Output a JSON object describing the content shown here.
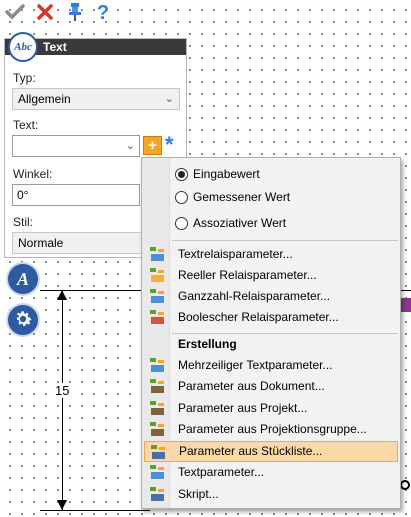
{
  "toolbar": {
    "icons": [
      "check-icon",
      "close-icon",
      "pin-icon",
      "help-icon"
    ],
    "help_glyph": "?"
  },
  "panel": {
    "title": "Text",
    "badge_text": "Abc",
    "type_label": "Typ:",
    "type_value": "Allgemein",
    "text_label": "Text:",
    "text_value": "",
    "plus_glyph": "+",
    "asterisk_glyph": "*",
    "angle_label": "Winkel:",
    "angle_value": "0°",
    "style_label": "Stil:",
    "style_value": "Normale"
  },
  "side_icons": {
    "font_badge": "A"
  },
  "dimension": {
    "value": "15"
  },
  "menu": {
    "radios": [
      {
        "label": "Eingabewert",
        "checked": true
      },
      {
        "label": "Gemessener Wert",
        "checked": false
      },
      {
        "label": "Assoziativer Wert",
        "checked": false
      }
    ],
    "relay_items": [
      {
        "label": "Textrelaisparameter...",
        "icon": "text-relay-icon"
      },
      {
        "label": "Reeller Relaisparameter...",
        "icon": "real-relay-icon"
      },
      {
        "label": "Ganzzahl-Relaisparameter...",
        "icon": "integer-relay-icon"
      },
      {
        "label": "Boolescher Relaisparameter...",
        "icon": "boolean-relay-icon"
      }
    ],
    "section_header": "Erstellung",
    "create_items": [
      {
        "label": "Mehrzeiliger Textparameter...",
        "icon": "multiline-text-icon"
      },
      {
        "label": "Parameter aus Dokument...",
        "icon": "document-parameter-icon"
      },
      {
        "label": "Parameter aus Projekt...",
        "icon": "project-parameter-icon"
      },
      {
        "label": "Parameter aus Projektionsgruppe...",
        "icon": "projection-group-icon"
      },
      {
        "label": "Parameter aus Stückliste...",
        "icon": "bom-parameter-icon",
        "highlighted": true
      },
      {
        "label": "Textparameter...",
        "icon": "text-parameter-icon"
      },
      {
        "label": "Skript...",
        "icon": "script-icon"
      }
    ]
  },
  "colors": {
    "accent": "#2d5aa0",
    "highlight": "#fbd9a6",
    "highlight_border": "#f0a848",
    "plus_button": "#f5a623"
  }
}
